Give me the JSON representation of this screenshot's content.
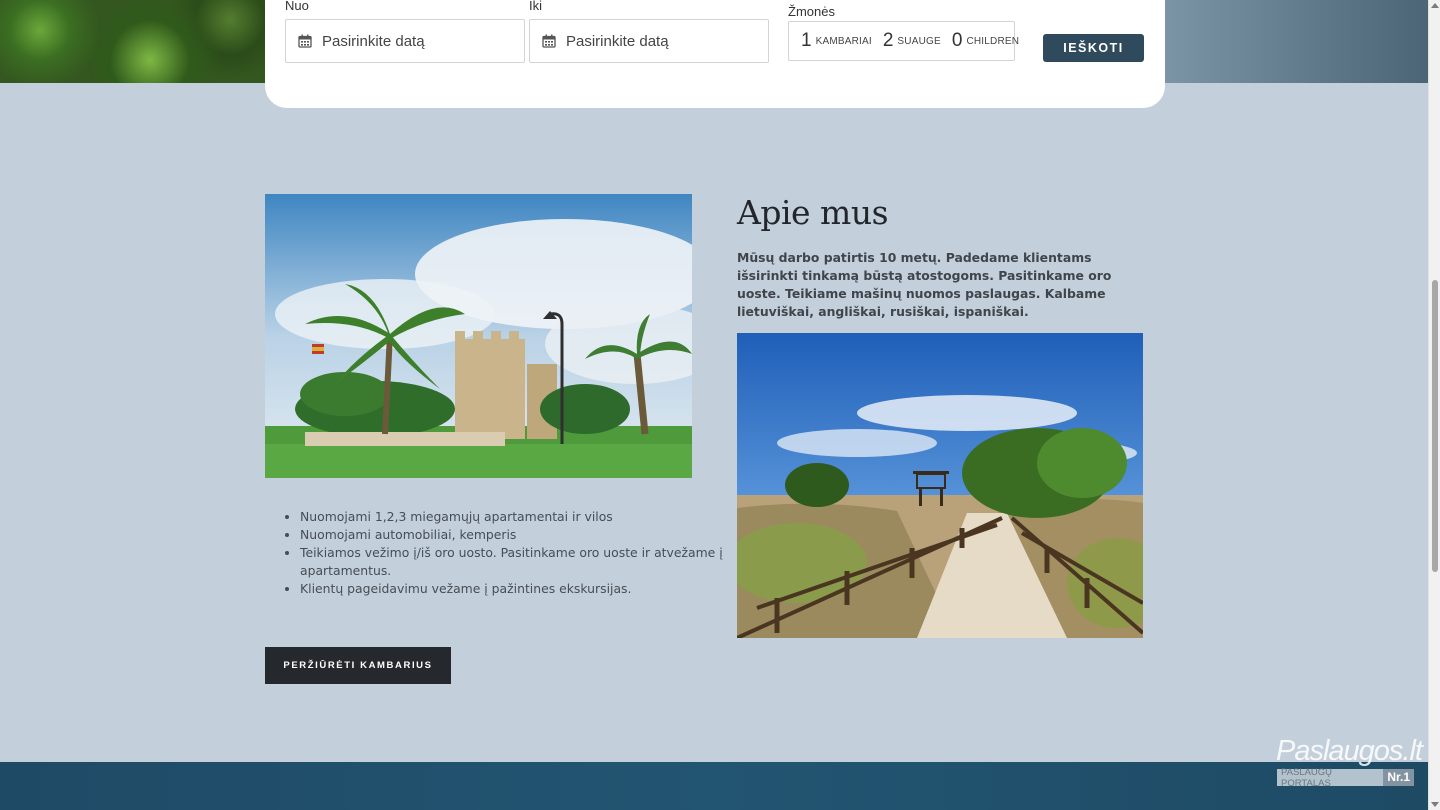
{
  "booking": {
    "from_label": "Nuo",
    "to_label": "Iki",
    "from_placeholder": "Pasirinkite datą",
    "to_placeholder": "Pasirinkite datą",
    "people_label": "Žmonės",
    "rooms_count": "1",
    "rooms_unit": "KAMBARIAI",
    "adults_count": "2",
    "adults_unit": "SUAUGE",
    "children_count": "0",
    "children_unit": "CHILDREN",
    "search_label": "IEŠKOTI"
  },
  "about": {
    "title": "Apie mus",
    "text": "Mūsų darbo patirtis 10 metų. Padedame klientams išsirinkti tinkamą būstą atostogoms. Pasitinkame oro uoste. Teikiame mašinų nuomos paslaugas. Kalbame lietuviškai, angliškai, rusiškai, ispaniškai.",
    "features": [
      "Nuomojami 1,2,3 miegamųjų apartamentai ir vilos",
      "Nuomojami automobiliai, kemperis",
      "Teikiamos vežimo į/iš oro uosto. Pasitinkame oro uoste ir atvežame į apartamentus.",
      "Klientų pageidavimu vežame į pažintines ekskursijas."
    ],
    "rooms_button": "PERŽIŪRĖTI KAMBARIUS"
  },
  "watermark": {
    "title": "Paslaugos.lt",
    "subtitle": "PASLAUGŲ PORTALAS",
    "badge": "Nr.1"
  },
  "colors": {
    "background": "#c3cfdb",
    "search_button": "#2f4a5d",
    "rooms_button": "#25292d",
    "footer_band": "#225572"
  }
}
